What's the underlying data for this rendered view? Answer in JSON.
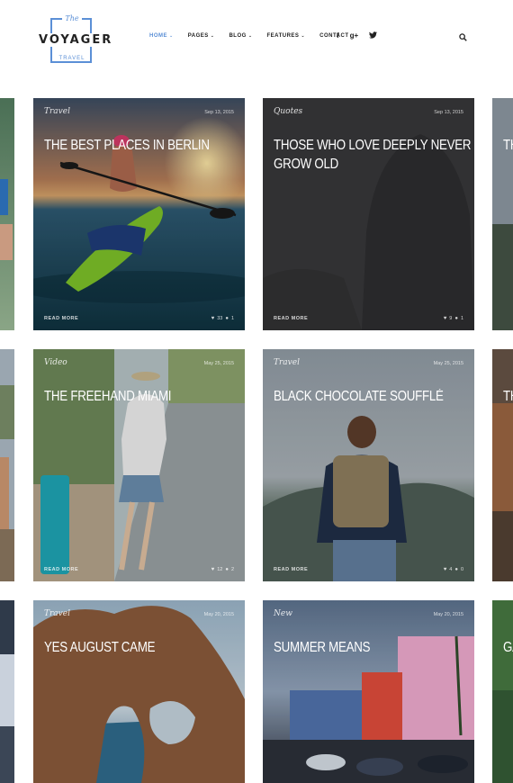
{
  "brand": {
    "the": "The",
    "name": "VOYAGER",
    "tag": "TRAVEL"
  },
  "nav": {
    "items": [
      {
        "label": "HOME",
        "active": true,
        "has_menu": true
      },
      {
        "label": "PAGES",
        "has_menu": true
      },
      {
        "label": "BLOG",
        "has_menu": true
      },
      {
        "label": "FEATURES",
        "has_menu": true
      },
      {
        "label": "CONTACT",
        "has_menu": false
      }
    ],
    "chevron": "⌄",
    "social": [
      "f",
      "g+",
      "twitter-icon"
    ],
    "accent": "#5b8fd6"
  },
  "posts": [
    {
      "category": "Travel",
      "date": "Sep 13, 2015",
      "title": "THE BEST PLACES IN BERLIN",
      "read_more": "READ MORE",
      "likes": "33",
      "comments": "1"
    },
    {
      "category": "Quotes",
      "date": "Sep 13, 2015",
      "title": "THOSE WHO LOVE DEEPLY NEVER GROW OLD",
      "read_more": "READ MORE",
      "likes": "9",
      "comments": "1"
    },
    {
      "category": "Video",
      "date": "May 25, 2015",
      "title": "THE FREEHAND MIAMI",
      "read_more": "READ MORE",
      "likes": "12",
      "comments": "2"
    },
    {
      "category": "Travel",
      "date": "May 25, 2015",
      "title": "BLACK CHOCOLATE SOUFFLÉ",
      "read_more": "READ MORE",
      "likes": "4",
      "comments": "0"
    },
    {
      "category": "Travel",
      "date": "May 20, 2015",
      "title": "YES AUGUST CAME"
    },
    {
      "category": "New",
      "date": "May 20, 2015",
      "title": "SUMMER MEANS"
    }
  ],
  "edge_titles": [
    "TH",
    "TH",
    "GA"
  ]
}
